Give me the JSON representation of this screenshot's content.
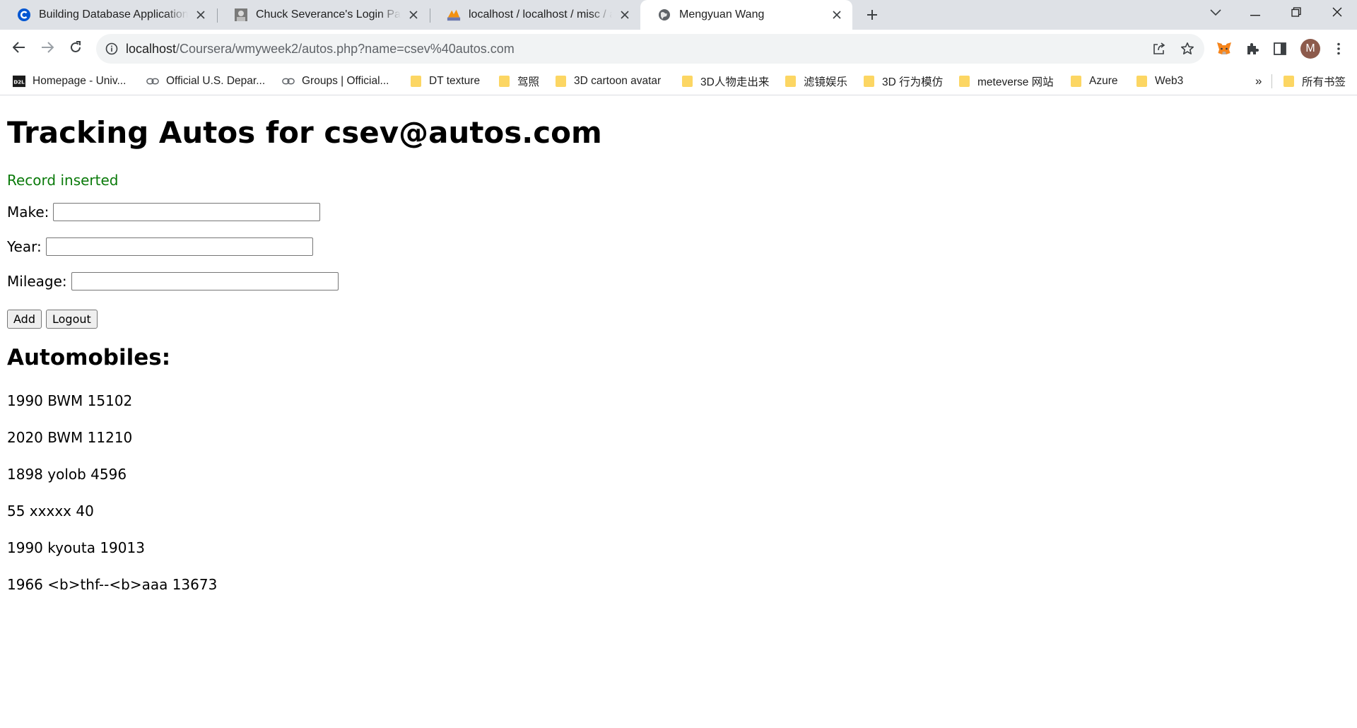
{
  "browser": {
    "tabs": [
      {
        "title": "Building Database Applications",
        "favicon": "coursera-icon",
        "active": false
      },
      {
        "title": "Chuck Severance's Login Page",
        "favicon": "person-photo-icon",
        "active": false
      },
      {
        "title": "localhost / localhost / misc / autos",
        "favicon": "phpmyadmin-icon",
        "active": false
      },
      {
        "title": "Mengyuan Wang",
        "favicon": "globe-icon",
        "active": true
      }
    ],
    "address": {
      "host": "localhost",
      "path": "/Coursera/wmyweek2/autos.php?name=csev%40autos.com"
    },
    "profile_initial": "M",
    "bookmarks": [
      {
        "label": "Homepage - Univ...",
        "icon": "d2l-icon"
      },
      {
        "label": "Official U.S. Depar...",
        "icon": "link-icon"
      },
      {
        "label": "Groups | Official...",
        "icon": "link-icon"
      },
      {
        "label": "DT texture",
        "icon": "folder-icon"
      },
      {
        "label": "驾照",
        "icon": "folder-icon"
      },
      {
        "label": "3D cartoon avatar",
        "icon": "folder-icon"
      },
      {
        "label": "3D人物走出来",
        "icon": "folder-icon"
      },
      {
        "label": "滤镜娱乐",
        "icon": "folder-icon"
      },
      {
        "label": "3D 行为模仿",
        "icon": "folder-icon"
      },
      {
        "label": "meteverse 网站",
        "icon": "folder-icon"
      },
      {
        "label": "Azure",
        "icon": "folder-icon"
      },
      {
        "label": "Web3",
        "icon": "folder-icon"
      }
    ],
    "overflow_label": "»",
    "other_bookmarks": "所有书签"
  },
  "page": {
    "heading": "Tracking Autos for csev@autos.com",
    "status_message": "Record inserted",
    "status_color": "#0a7a0a",
    "fields": {
      "make_label": "Make:",
      "year_label": "Year:",
      "mileage_label": "Mileage:",
      "make_value": "",
      "year_value": "",
      "mileage_value": ""
    },
    "add_label": "Add",
    "logout_label": "Logout",
    "list_heading": "Automobiles:",
    "autos": [
      "1990 BWM 15102",
      "2020 BWM 11210",
      "1898 yolob 4596",
      "55 xxxxx 40",
      "1990 kyouta 19013",
      "1966 <b>thf--<b>aaa 13673"
    ]
  }
}
